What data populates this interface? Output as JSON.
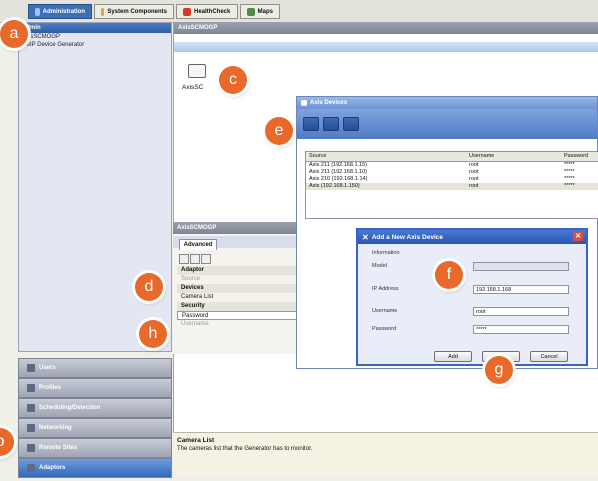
{
  "top_tabs": [
    {
      "label": "Administration",
      "active": true
    },
    {
      "label": "System Components",
      "active": false
    },
    {
      "label": "HealthCheck",
      "active": false
    },
    {
      "label": "Maps",
      "active": false
    }
  ],
  "left_panel": {
    "header": "Admin",
    "tree": [
      "AxisSCMOGP",
      "VSIP Device Generator"
    ]
  },
  "nav_buttons": [
    "Users",
    "Profiles",
    "Scheduling/Detection",
    "Networking",
    "Remote Sites",
    "Adaptors"
  ],
  "right_pane": {
    "header": "AxisSCMOGP",
    "device_label": "AxisSC"
  },
  "properties": {
    "header": "AxisSCMOGP",
    "tab": "Advanced",
    "rows": [
      {
        "text": "Adaptor",
        "type": "cat"
      },
      {
        "text": "Source",
        "type": "item"
      },
      {
        "text": "Devices",
        "type": "cat"
      },
      {
        "text": "Camera List",
        "type": "item"
      },
      {
        "text": "Security",
        "type": "cat"
      },
      {
        "text": "Password",
        "type": "sel"
      },
      {
        "text": "Username",
        "type": "item"
      }
    ]
  },
  "info": {
    "title": "Camera List",
    "text": "The cameras list that the Generator has to monitor."
  },
  "axis_window": {
    "title": "Axis Devices",
    "columns": [
      "Source",
      "Username",
      "Password"
    ],
    "rows": [
      {
        "source": "Axis 211 (192.168.1.15)",
        "username": "root",
        "password": "*****"
      },
      {
        "source": "Axis 211 (192.168.1.10)",
        "username": "root",
        "password": "*****"
      },
      {
        "source": "Axis 210 (192.168.1.14)",
        "username": "root",
        "password": "*****"
      },
      {
        "source": "Axis (192.168.1.150)",
        "username": "root",
        "password": "*****"
      }
    ]
  },
  "add_dialog": {
    "title": "Add a New Axis Device",
    "section": "Information",
    "fields": [
      {
        "label": "Model",
        "value": ""
      },
      {
        "label": "IP Address",
        "value": "192.168.1.168"
      },
      {
        "label": "Username",
        "value": "root"
      },
      {
        "label": "Password",
        "value": "*****"
      }
    ],
    "buttons": [
      "Add",
      "",
      "Cancel"
    ]
  },
  "callouts": [
    "a",
    "b",
    "c",
    "d",
    "e",
    "f",
    "g",
    "h"
  ],
  "colors": {
    "accent": "#e8692a",
    "title_blue": "#2855b0"
  }
}
